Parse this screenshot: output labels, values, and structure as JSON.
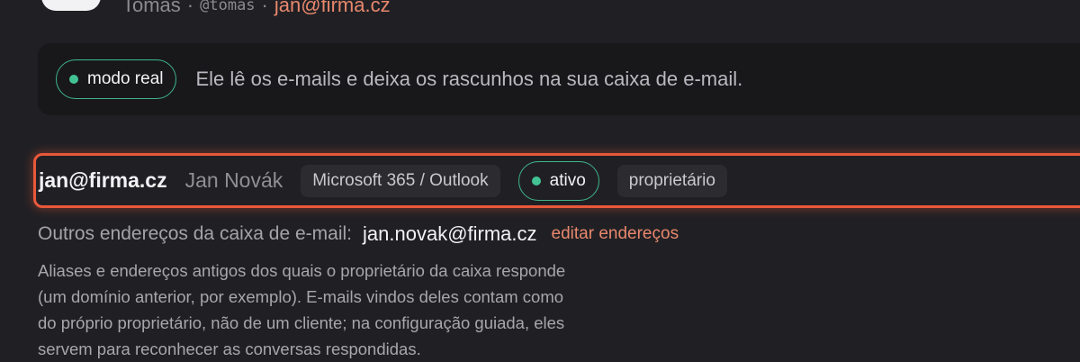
{
  "profile": {
    "name": "Tomas",
    "handle": "@tomas",
    "separator": "·",
    "email": "jan@firma.cz"
  },
  "banner": {
    "mode_label": "modo real",
    "description": "Ele lê os e-mails e deixa os rascunhos na sua caixa de e-mail."
  },
  "account": {
    "email": "jan@firma.cz",
    "name": "Jan Novák",
    "provider": "Microsoft 365 / Outlook",
    "status": "ativo",
    "role": "proprietário"
  },
  "aliases": {
    "label": "Outros endereços da caixa de e-mail:",
    "value": "jan.novak@firma.cz",
    "edit_label": "editar endereços",
    "help_lines": [
      "Aliases e endereços antigos dos quais o proprietário da caixa responde",
      "(um domínio anterior, por exemplo). E-mails vindos deles contam como",
      "do próprio proprietário, não de um cliente; na configuração guiada, eles",
      "servem para reconhecer as conversas respondidas."
    ]
  },
  "colors": {
    "accent": "#e8876d",
    "highlight_border": "#e8583a",
    "status_green": "#43c393",
    "background": "#202024"
  },
  "icons": {
    "status_dot": "green-dot-icon"
  }
}
